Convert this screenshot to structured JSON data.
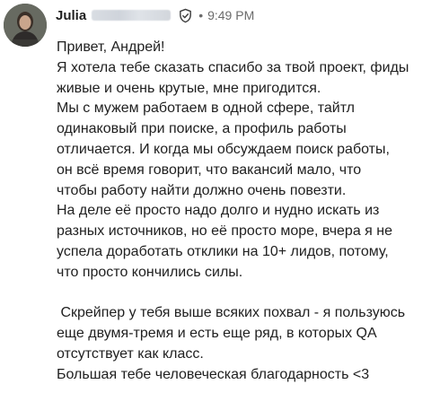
{
  "message": {
    "sender_name": "Julia",
    "separator": "•",
    "timestamp": "9:49 PM",
    "lines_part1": [
      "Привет, Андрей!",
      "Я хотела тебе сказать спасибо за твой проект, фиды",
      "живые и очень крутые, мне пригодится.",
      "Мы с мужем работаем в одной сфере, тайтл",
      "одинаковый при поиске, а профиль работы",
      "отличается. И когда мы обсуждаем поиск работы,",
      "он всё время говорит, что вакансий мало, что",
      "чтобы работу найти должно очень повезти.",
      "На деле её просто надо долго и нудно искать из",
      "разных источников, но её просто море, вчера я не",
      "успела доработать отклики на 10+ лидов, потому,",
      "что просто кончились силы."
    ],
    "lines_part2": [
      " Скрейпер у тебя выше всяких похвал - я пользуюсь",
      "еще двумя-тремя и есть еще ряд, в которых QA",
      "отсутствует как класс.",
      "Большая тебе человеческая благодарность <3"
    ]
  }
}
